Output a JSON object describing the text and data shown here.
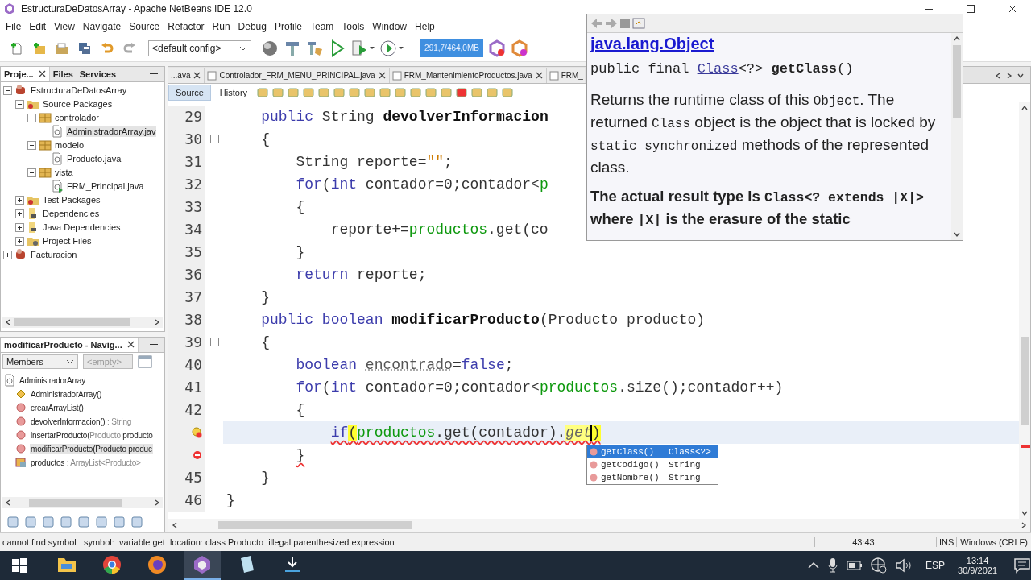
{
  "window": {
    "title": "EstructuraDeDatosArray - Apache NetBeans IDE 12.0"
  },
  "menu": [
    "File",
    "Edit",
    "View",
    "Navigate",
    "Source",
    "Refactor",
    "Run",
    "Debug",
    "Profile",
    "Team",
    "Tools",
    "Window",
    "Help"
  ],
  "toolbar": {
    "config": "<default config>",
    "memory": "291,7/464,0MB"
  },
  "project_panel": {
    "tabs": [
      {
        "label": "Proje...",
        "selected": true
      },
      {
        "label": "Files",
        "selected": false
      },
      {
        "label": "Services",
        "selected": false
      }
    ],
    "tree": [
      {
        "label": "EstructuraDeDatosArray",
        "kind": "project",
        "expanded": true,
        "selected": false,
        "children": [
          {
            "label": "Source Packages",
            "kind": "sources",
            "expanded": true,
            "selected": false,
            "children": [
              {
                "label": "controlador",
                "kind": "package",
                "expanded": true,
                "selected": false,
                "children": [
                  {
                    "label": "AdministradorArray.jav",
                    "kind": "class",
                    "selected": true
                  }
                ]
              },
              {
                "label": "modelo",
                "kind": "package",
                "expanded": true,
                "selected": false,
                "children": [
                  {
                    "label": "Producto.java",
                    "kind": "class",
                    "selected": false
                  }
                ]
              },
              {
                "label": "vista",
                "kind": "package",
                "expanded": true,
                "selected": false,
                "children": [
                  {
                    "label": "FRM_Principal.java",
                    "kind": "form",
                    "selected": false
                  }
                ]
              }
            ]
          },
          {
            "label": "Test Packages",
            "kind": "sources",
            "expanded": false,
            "selected": false
          },
          {
            "label": "Dependencies",
            "kind": "library",
            "expanded": false,
            "selected": false
          },
          {
            "label": "Java Dependencies",
            "kind": "library",
            "expanded": false,
            "selected": false
          },
          {
            "label": "Project Files",
            "kind": "config",
            "expanded": false,
            "selected": false
          }
        ]
      },
      {
        "label": "Facturacion",
        "kind": "project",
        "expanded": false,
        "selected": false
      }
    ]
  },
  "navigator": {
    "title": "modificarProducto - Navig...",
    "filter": "Members",
    "filter_value": "<empty>",
    "tree": [
      {
        "name": "AdministradorArray",
        "kind": "class",
        "selected": false,
        "children": [
          {
            "name": "AdministradorArray()",
            "kind": "constructor",
            "selected": false
          },
          {
            "name": "crearArrayList()",
            "kind": "method",
            "selected": false
          },
          {
            "name": "devolverInformacion() ",
            "detail": ": String",
            "kind": "method",
            "selected": false
          },
          {
            "name": "insertarProducto(",
            "detail": "Producto",
            "rest": " producto",
            "kind": "method",
            "selected": false
          },
          {
            "name": "modificarProducto(Producto produc",
            "kind": "method",
            "selected": true
          },
          {
            "name": "productos ",
            "detail": ": ArrayList<Producto>",
            "kind": "field",
            "selected": false
          }
        ]
      }
    ]
  },
  "editor": {
    "tabs": [
      {
        "label": "...ava",
        "selected": false
      },
      {
        "label": "Controlador_FRM_MENU_PRINCIPAL.java",
        "selected": false
      },
      {
        "label": "FRM_MantenimientoProductos.java",
        "selected": false
      },
      {
        "label": "FRM_",
        "selected": false
      }
    ],
    "view_tabs": [
      {
        "label": "Source",
        "selected": true
      },
      {
        "label": "History",
        "selected": false
      }
    ],
    "lines": [
      {
        "kind": "numbered",
        "number": "29",
        "current": false,
        "error": false,
        "fold": false,
        "tokens": [
          {
            "t": "    public",
            "kind": "keyword"
          },
          {
            "t": " String ",
            "kind": "plain"
          },
          {
            "t": "devolverInformacion",
            "kind": "declaration"
          }
        ]
      },
      {
        "kind": "numbered",
        "number": "30",
        "current": false,
        "error": false,
        "fold": true,
        "tokens": [
          {
            "t": "    {",
            "kind": "plain"
          }
        ]
      },
      {
        "kind": "numbered",
        "number": "31",
        "current": false,
        "error": false,
        "fold": false,
        "tokens": [
          {
            "t": "        String reporte=",
            "kind": "plain"
          },
          {
            "t": "\"\"",
            "kind": "string"
          },
          {
            "t": ";",
            "kind": "plain"
          }
        ]
      },
      {
        "kind": "numbered",
        "number": "32",
        "current": false,
        "error": false,
        "fold": false,
        "tokens": [
          {
            "t": "        for",
            "kind": "keyword"
          },
          {
            "t": "(",
            "kind": "plain"
          },
          {
            "t": "int",
            "kind": "keyword"
          },
          {
            "t": " contador=0;contador<",
            "kind": "plain"
          },
          {
            "t": "p",
            "kind": "field"
          }
        ]
      },
      {
        "kind": "numbered",
        "number": "33",
        "current": false,
        "error": false,
        "fold": false,
        "tokens": [
          {
            "t": "        {",
            "kind": "plain"
          }
        ]
      },
      {
        "kind": "numbered",
        "number": "34",
        "current": false,
        "error": false,
        "fold": false,
        "tokens": [
          {
            "t": "            reporte+=",
            "kind": "plain"
          },
          {
            "t": "productos",
            "kind": "field"
          },
          {
            "t": ".get(co",
            "kind": "plain"
          }
        ]
      },
      {
        "kind": "numbered",
        "number": "35",
        "current": false,
        "error": false,
        "fold": false,
        "tokens": [
          {
            "t": "        }",
            "kind": "plain"
          }
        ]
      },
      {
        "kind": "numbered",
        "number": "36",
        "current": false,
        "error": false,
        "fold": false,
        "tokens": [
          {
            "t": "        return",
            "kind": "keyword"
          },
          {
            "t": " reporte;",
            "kind": "plain"
          }
        ]
      },
      {
        "kind": "numbered",
        "number": "37",
        "current": false,
        "error": false,
        "fold": false,
        "tokens": [
          {
            "t": "    }",
            "kind": "plain"
          }
        ]
      },
      {
        "kind": "numbered",
        "number": "38",
        "current": false,
        "error": false,
        "fold": false,
        "tokens": [
          {
            "t": "    public",
            "kind": "keyword"
          },
          {
            "t": " boolean",
            "kind": "keyword"
          },
          {
            "t": " modificarProducto",
            "kind": "declaration"
          },
          {
            "t": "(Producto producto)",
            "kind": "plain"
          }
        ]
      },
      {
        "kind": "numbered",
        "number": "39",
        "current": false,
        "error": false,
        "fold": true,
        "tokens": [
          {
            "t": "    {",
            "kind": "plain"
          }
        ]
      },
      {
        "kind": "numbered",
        "number": "40",
        "current": false,
        "error": false,
        "fold": false,
        "tokens": [
          {
            "t": "        boolean",
            "kind": "keyword"
          },
          {
            "t": " encontrado",
            "kind": "unused"
          },
          {
            "t": "=",
            "kind": "plain"
          },
          {
            "t": "false",
            "kind": "keyword"
          },
          {
            "t": ";",
            "kind": "plain"
          }
        ]
      },
      {
        "kind": "numbered",
        "number": "41",
        "current": false,
        "error": false,
        "fold": false,
        "tokens": [
          {
            "t": "        for",
            "kind": "keyword"
          },
          {
            "t": "(",
            "kind": "plain"
          },
          {
            "t": "int",
            "kind": "keyword"
          },
          {
            "t": " contador=0;contador<",
            "kind": "plain"
          },
          {
            "t": "productos",
            "kind": "field"
          },
          {
            "t": ".size();contador++)",
            "kind": "plain"
          }
        ]
      },
      {
        "kind": "numbered",
        "number": "42",
        "current": false,
        "error": false,
        "fold": false,
        "tokens": [
          {
            "t": "        {",
            "kind": "plain"
          }
        ]
      },
      {
        "kind": "hint",
        "current": true,
        "error": true,
        "fold": false,
        "tokens": [
          {
            "t": "            if",
            "kind": "keyword"
          },
          {
            "t": "(",
            "kind": "match"
          },
          {
            "t": "productos",
            "kind": "field"
          },
          {
            "t": ".get(contador).",
            "kind": "plain"
          },
          {
            "t": "get",
            "kind": "typed"
          },
          {
            "t": ")",
            "kind": "match"
          }
        ]
      },
      {
        "kind": "error",
        "current": false,
        "error": true,
        "fold": false,
        "tokens": [
          {
            "t": "        }",
            "kind": "plain"
          }
        ]
      },
      {
        "kind": "numbered",
        "number": "45",
        "current": false,
        "error": false,
        "fold": false,
        "tokens": [
          {
            "t": "    }",
            "kind": "plain"
          }
        ]
      },
      {
        "kind": "numbered",
        "number": "46",
        "current": false,
        "error": false,
        "fold": false,
        "tokens": [
          {
            "t": "}",
            "kind": "plain"
          }
        ]
      }
    ]
  },
  "completion": [
    {
      "name": "getClass()",
      "type": "Class<?>",
      "selected": true
    },
    {
      "name": "getCodigo()",
      "type": "String",
      "selected": false
    },
    {
      "name": "getNombre()",
      "type": "String",
      "selected": false
    }
  ],
  "javadoc": {
    "link": "java.lang.Object",
    "signature": [
      {
        "t": "public final ",
        "kind": "plain"
      },
      {
        "t": "Class",
        "kind": "link"
      },
      {
        "t": "<?> ",
        "kind": "plain"
      },
      {
        "t": "getClass",
        "kind": "declaration"
      },
      {
        "t": "()",
        "kind": "plain"
      }
    ],
    "paragraphs": [
      {
        "bold": false,
        "parts": [
          {
            "t": "Returns the runtime class of this ",
            "kind": "text"
          },
          {
            "t": "Object",
            "kind": "code"
          },
          {
            "t": ". The returned ",
            "kind": "text"
          },
          {
            "t": "Class",
            "kind": "code"
          },
          {
            "t": " object is the object that is locked by ",
            "kind": "text"
          },
          {
            "t": "static synchronized",
            "kind": "code"
          },
          {
            "t": " methods of the represented class.",
            "kind": "text"
          }
        ]
      },
      {
        "bold": true,
        "parts": [
          {
            "t": "The actual result type is ",
            "kind": "text"
          },
          {
            "t": "Class<? extends |X|>",
            "kind": "code"
          },
          {
            "t": " where ",
            "kind": "text"
          },
          {
            "t": "|X|",
            "kind": "code"
          },
          {
            "t": " is the erasure of the static",
            "kind": "text"
          }
        ]
      }
    ]
  },
  "status_bar": {
    "message": "cannot find symbol   symbol:  variable get  location: class Producto  illegal parenthesized expression",
    "position": "43:43",
    "mode": "INS",
    "line_endings": "Windows (CRLF)"
  },
  "taskbar": {
    "apps": [
      {
        "kind": "explorer",
        "active": false
      },
      {
        "kind": "chrome",
        "active": false
      },
      {
        "kind": "firefox",
        "active": false
      },
      {
        "kind": "netbeans",
        "active": true
      },
      {
        "kind": "notepad",
        "active": false
      },
      {
        "kind": "installer",
        "active": false
      }
    ],
    "language": "ESP",
    "time": "13:14",
    "date": "30/9/2021"
  }
}
